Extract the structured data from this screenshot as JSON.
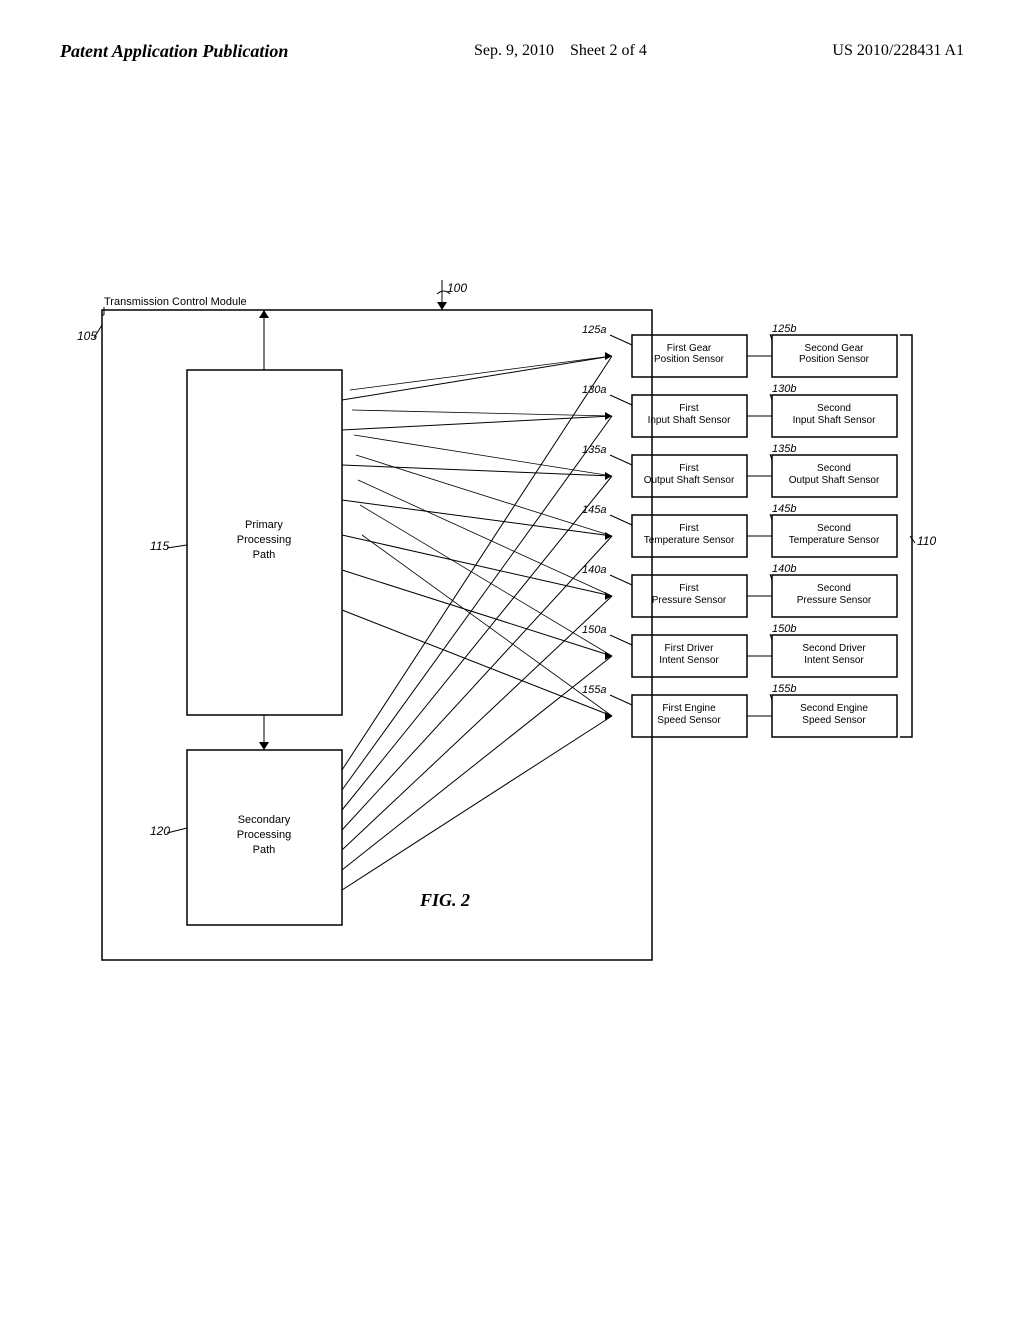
{
  "header": {
    "left_label": "Patent Application Publication",
    "center_date": "Sep. 9, 2010",
    "center_sheet": "Sheet 2 of 4",
    "right_pub": "US 2010/228431 A1"
  },
  "diagram": {
    "fig_label": "FIG. 2",
    "ref_100": "100",
    "ref_105": "105",
    "ref_110": "110",
    "ref_115": "115",
    "ref_120": "120",
    "ref_125a": "125a",
    "ref_125b": "125b",
    "ref_130a": "130a",
    "ref_130b": "130b",
    "ref_135a": "135a",
    "ref_135b": "135b",
    "ref_145a": "145a",
    "ref_145b": "145b",
    "ref_140a": "140a",
    "ref_140b": "140b",
    "ref_150a": "150a",
    "ref_150b": "150b",
    "ref_155a": "155a",
    "ref_155b": "155b",
    "tcm_label": "Transmission Control Module",
    "primary_label": "Primary\nProcessing\nPath",
    "secondary_label": "Secondary\nProcessing\nPath",
    "sensor_125a": "First Gear\nPosition Sensor",
    "sensor_125b": "Second Gear\nPosition Sensor",
    "sensor_130a": "First\nInput Shaft Sensor",
    "sensor_130b": "Second\nInput Shaft Sensor",
    "sensor_135a": "First\nOutput Shaft Sensor",
    "sensor_135b": "Second\nOutput Shaft Sensor",
    "sensor_145a": "First\nTemperature Sensor",
    "sensor_145b": "Second\nTemperature Sensor",
    "sensor_140a": "First\nPressure Sensor",
    "sensor_140b": "Second\nPressure Sensor",
    "sensor_150a": "First Driver\nIntent Sensor",
    "sensor_150b": "Second Driver\nIntent Sensor",
    "sensor_155a": "First Engine\nSpeed Sensor",
    "sensor_155b": "Second Engine\nSpeed Sensor"
  }
}
